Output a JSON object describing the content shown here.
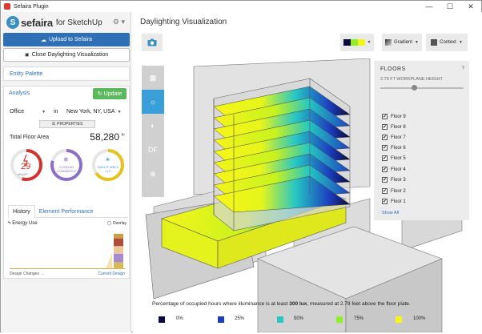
{
  "window": {
    "title": "Sefaira Plugin",
    "min": "—",
    "max": "☐",
    "close": "✕"
  },
  "brand": {
    "mark": "S",
    "name": "sefaira",
    "sub": "for SketchUp",
    "settings_icon": "gear-icon"
  },
  "buttons": {
    "upload": "Upload to Sefaira",
    "close_daylighting": "Close Daylighting Visualization"
  },
  "entity_palette": "Entity Palette",
  "analysis": {
    "title": "Analysis",
    "update": "Update",
    "building_type": "Office",
    "in": "in",
    "location": "New York, NY, USA",
    "properties": "PROPERTIES",
    "total_floor_area_label": "Total Floor Area",
    "total_floor_area_value": "58,280",
    "total_floor_area_unit": "ft²",
    "gauges": [
      {
        "name": "energy",
        "value": "29",
        "unit": "kBtu/ft²",
        "color": "#d0342c",
        "fill": 0.55
      },
      {
        "name": "cooling",
        "value": "COOLING DOMINATED",
        "color": "#8b6fc7",
        "fill": 0.8
      },
      {
        "name": "daylight",
        "value": "DAYLIT WELL LIT",
        "color": "#e8c11f",
        "fill": 0.65
      }
    ],
    "tabs": [
      "History",
      "Element Performance"
    ],
    "energy_use_label": "Energy Use",
    "overlay_label": "Overlay",
    "history_axis_left": "Design Changes →",
    "history_axis_right": "Current Design",
    "history_bars": [
      {
        "color": "#d9b85a",
        "value": 0.18
      },
      {
        "color": "#a78bd0",
        "value": 0.22
      },
      {
        "color": "#e8c79a",
        "value": 0.2
      },
      {
        "color": "#b04c3c",
        "value": 0.2
      },
      {
        "color": "#c9a048",
        "value": 0.12
      }
    ]
  },
  "main": {
    "heading": "Daylighting Visualization",
    "camera_icon": "camera-icon",
    "color_scheme": "",
    "gradient": "Gradient",
    "context": "Context",
    "toolbar": [
      {
        "icon": "calendar-icon",
        "glyph": "▦"
      },
      {
        "icon": "sun-icon",
        "glyph": "☼"
      },
      {
        "icon": "contrast-icon",
        "glyph": "◐"
      },
      {
        "icon": "df-icon",
        "glyph": "DF"
      },
      {
        "icon": "target-icon",
        "glyph": "⊕"
      }
    ]
  },
  "floors": {
    "title": "FLOORS",
    "help": "?",
    "subtitle": "2.79 FT WORKPLANE HEIGHT",
    "items": [
      "Floor 9",
      "Floor 8",
      "Floor 7",
      "Floor 6",
      "Floor 5",
      "Floor 4",
      "Floor 3",
      "Floor 2",
      "Floor 1"
    ],
    "show_all": "Show All"
  },
  "caption": {
    "pre": "Percentage of occupied hours where illuminance is at least ",
    "bold": "300 lux",
    "post": ", measured at 2.79 feet above the floor plate."
  },
  "legend": [
    {
      "label": "0%",
      "color": "#0a0a3c"
    },
    {
      "label": "25%",
      "color": "#1c3fbf"
    },
    {
      "label": "50%",
      "color": "#26c7c4"
    },
    {
      "label": "75%",
      "color": "#8ef028"
    },
    {
      "label": "100%",
      "color": "#f5f51a"
    }
  ]
}
